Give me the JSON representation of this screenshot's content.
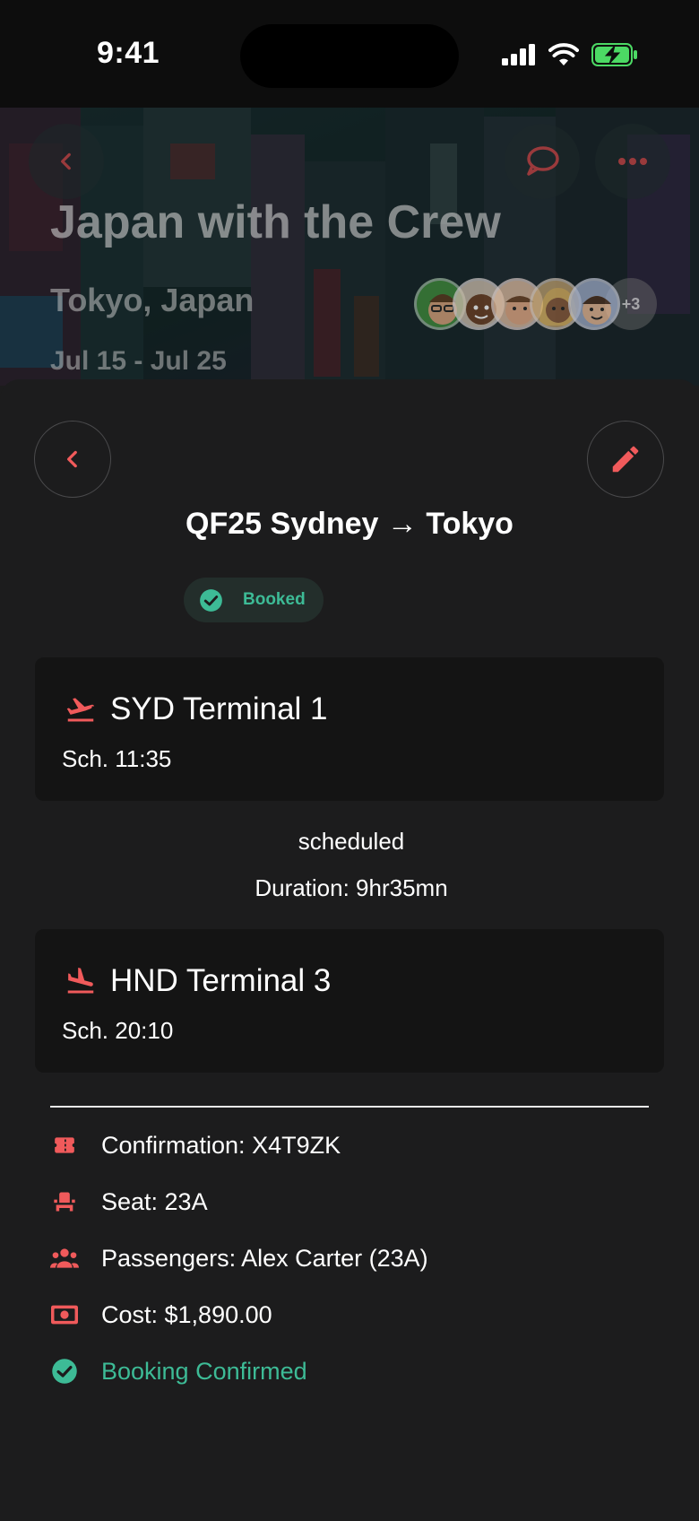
{
  "status_bar": {
    "time": "9:41"
  },
  "trip": {
    "title": "Japan with the Crew",
    "location": "Tokyo, Japan",
    "dates": "Jul 15 - Jul 25",
    "members_extra": "+3"
  },
  "flight": {
    "title": "QF25 Sydney → Tokyo",
    "status_badge": "Booked",
    "departure": {
      "airport": "SYD Terminal 1",
      "time": "Sch. 11:35"
    },
    "status_text": "scheduled",
    "duration": "Duration: 9hr35mn",
    "arrival": {
      "airport": "HND Terminal 3",
      "time": "Sch. 20:10"
    }
  },
  "details": {
    "confirmation": "Confirmation: X4T9ZK",
    "seat": "Seat: 23A",
    "passengers": "Passengers: Alex Carter (23A)",
    "cost": "Cost: $1,890.00",
    "booking_status": "Booking Confirmed"
  },
  "colors": {
    "accent": "#f05a5b",
    "success": "#3dbb96",
    "background": "#1c1c1d",
    "card": "#141414"
  },
  "icons": [
    "back-icon",
    "chat-icon",
    "more-icon",
    "edit-icon",
    "flight-takeoff-icon",
    "flight-land-icon",
    "ticket-icon",
    "seat-icon",
    "group-icon",
    "money-icon",
    "check-circle-icon"
  ]
}
